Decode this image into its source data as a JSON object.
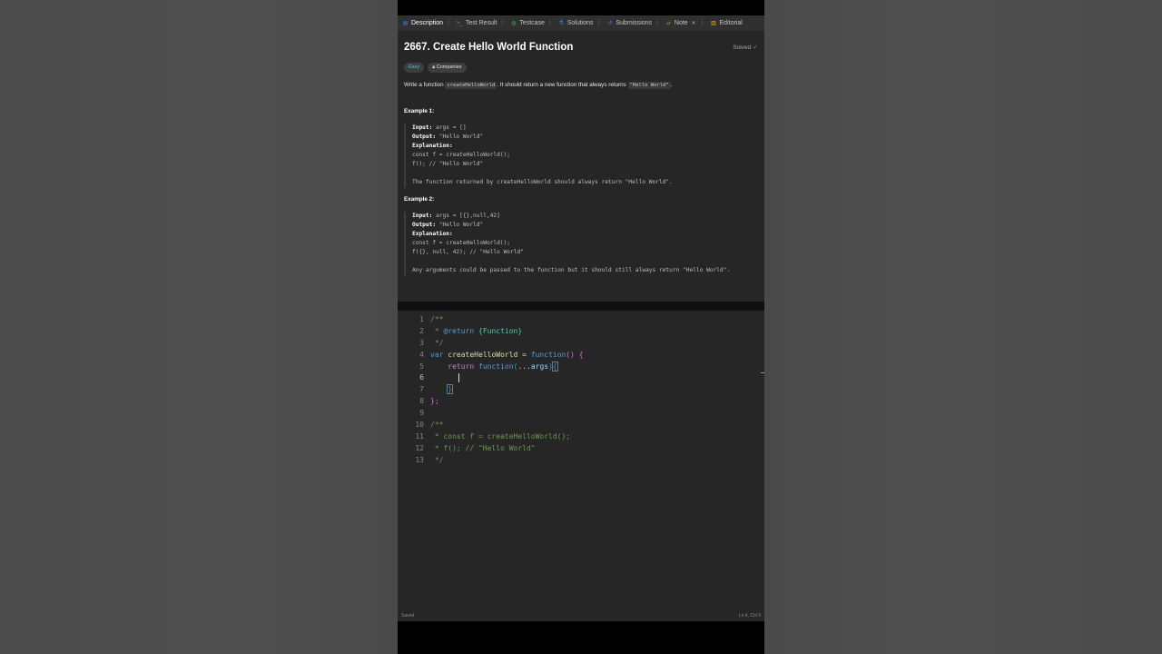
{
  "tabs": [
    {
      "label": "Description",
      "icon": "doc-icon"
    },
    {
      "label": "Test Result",
      "icon": "terminal-icon"
    },
    {
      "label": "Testcase",
      "icon": "check-circle-icon"
    },
    {
      "label": "Solutions",
      "icon": "flask-icon"
    },
    {
      "label": "Submissions",
      "icon": "history-icon"
    },
    {
      "label": "Note",
      "icon": "note-icon"
    },
    {
      "label": "Editorial",
      "icon": "book-icon"
    }
  ],
  "problem": {
    "title": "2667. Create Hello World Function",
    "status": "Solved",
    "difficulty": "Easy",
    "companies_label": "Companies",
    "statement_before": "Write a function ",
    "statement_code1": "createHelloWorld",
    "statement_mid": ". It should return a new function that always returns ",
    "statement_code2": "\"Hello World\"",
    "statement_after": "."
  },
  "examples": [
    {
      "title": "Example 1:",
      "input_label": "Input:",
      "input_value": " args = []",
      "output_label": "Output:",
      "output_value": " \"Hello World\"",
      "explanation_label": "Explanation:",
      "code_line1": "const f = createHelloWorld();",
      "code_line2": "f(); // \"Hello World\"",
      "note": "The function returned by createHelloWorld should always return \"Hello World\"."
    },
    {
      "title": "Example 2:",
      "input_label": "Input:",
      "input_value": " args = [{},null,42]",
      "output_label": "Output:",
      "output_value": " \"Hello World\"",
      "explanation_label": "Explanation:",
      "code_line1": "const f = createHelloWorld();",
      "code_line2": "f({}, null, 42); // \"Hello World\"",
      "note": "Any arguments could be passed to the function but it should still always return \"Hello World\"."
    }
  ],
  "editor": {
    "line_numbers": [
      "1",
      "2",
      "3",
      "4",
      "5",
      "6",
      "7",
      "8",
      "9",
      "10",
      "11",
      "12",
      "13"
    ],
    "tokens": {
      "doc_open": "/**",
      "doc_star": " * ",
      "doc_tag": "@return",
      "doc_type": "{Function}",
      "doc_close": " */",
      "kw_var": "var",
      "fn_name": "createHelloWorld",
      "eq": " = ",
      "kw_function": "function",
      "parens_open": "()",
      "brace_open": "{",
      "indent": "    ",
      "kw_return": "return",
      "inner_fn": "function",
      "paren_l": "(",
      "spread": "...",
      "args": "args",
      "paren_r": ")",
      "inner_brace_open": "{",
      "inner_brace_close": "}",
      "outer_close": "};",
      "cm_open": "/**",
      "cm_line1": " * const f = createHelloWorld();",
      "cm_line2": " * f(); // \"Hello World\"",
      "cm_close": " */"
    },
    "status_left": "Saved",
    "status_right": "Ln 6, Col 9"
  }
}
